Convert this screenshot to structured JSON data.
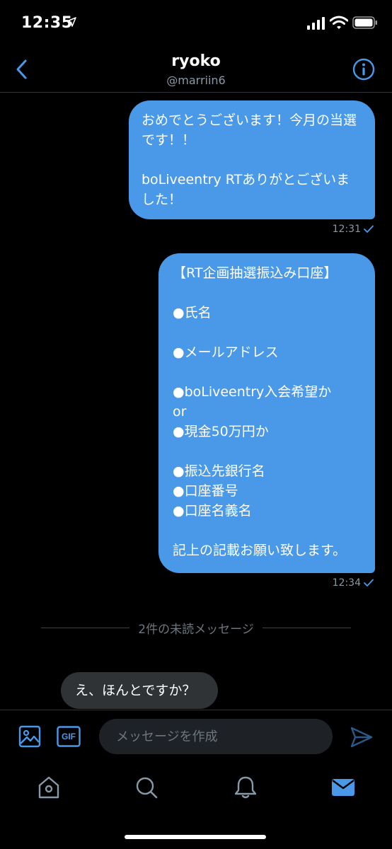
{
  "status_bar": {
    "time": "12:35"
  },
  "header": {
    "title": "ryoko",
    "handle": "@marriin6"
  },
  "messages": [
    {
      "direction": "outgoing",
      "text": "おめでとうございます！今月の当選です！！\n\nboLiveentry RTありがとございました！",
      "time": "12:31"
    },
    {
      "direction": "outgoing",
      "text": "【RT企画抽選振込み口座】\n\n●氏名\n\n●メールアドレス\n\n●boLiveentry入会希望か\nor\n●現金50万円か\n\n●振込先銀行名\n●口座番号\n●口座名義名\n\n記上の記載お願い致します。",
      "time": "12:34"
    }
  ],
  "unread_divider": "2件の未読メッセージ",
  "incoming": [
    {
      "direction": "incoming",
      "text": "え、ほんとですか？"
    }
  ],
  "composer": {
    "placeholder": "メッセージを作成",
    "gif_label": "GIF"
  },
  "colors": {
    "accent": "#4a99e9",
    "background": "#000000",
    "incoming_bubble": "#2f3336",
    "muted_text": "#8899a6"
  },
  "icons": {
    "back": "chevron-left-icon",
    "info": "info-icon",
    "photo": "image-icon",
    "gif": "gif-icon",
    "send": "send-icon",
    "home": "home-icon",
    "search": "search-icon",
    "notifications": "bell-icon",
    "messages": "envelope-icon"
  }
}
